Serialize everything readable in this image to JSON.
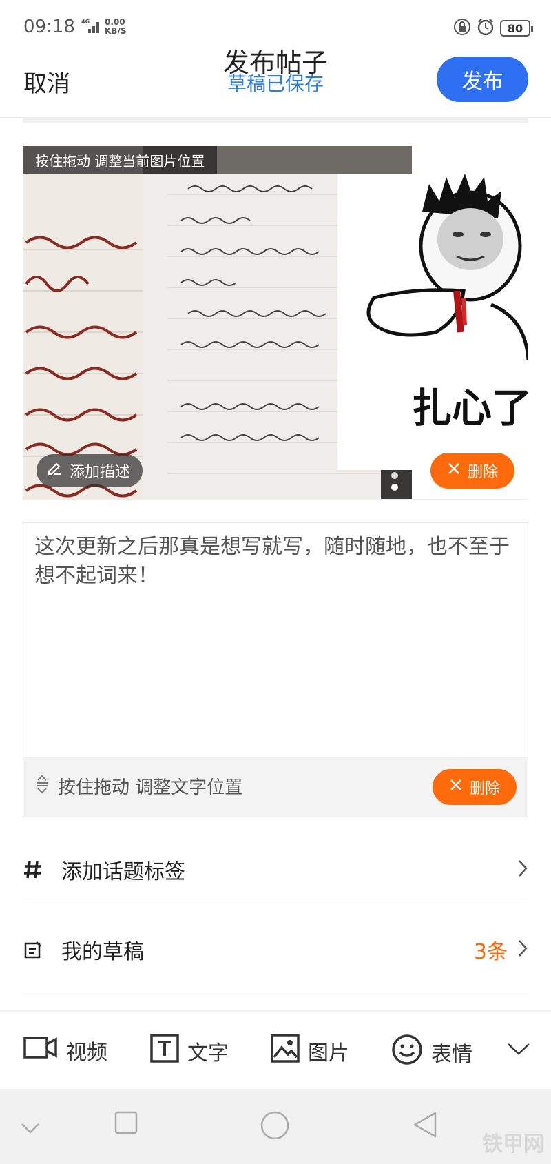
{
  "status_bar": {
    "time": "09:18",
    "network": "4G",
    "speed_value": "0.00",
    "speed_unit": "KB/S",
    "battery": "80"
  },
  "header": {
    "cancel_label": "取消",
    "title": "发布帖子",
    "subtitle": "草稿已保存",
    "publish_label": "发布"
  },
  "image_card": {
    "drag_hint": "按住拖动 调整当前图片位置",
    "add_description_label": "添加描述",
    "delete_label": "删除",
    "meme_text": "扎心了"
  },
  "text_block": {
    "content": "这次更新之后那真是想写就写，随时随地，也不至于想不起词来！",
    "drag_hint": "按住拖动 调整文字位置",
    "delete_label": "删除"
  },
  "rows": {
    "topic": {
      "label": "添加话题标签"
    },
    "drafts": {
      "label": "我的草稿",
      "count": "3条"
    }
  },
  "toolbar": {
    "video": "视频",
    "text": "文字",
    "image": "图片",
    "emoji": "表情"
  },
  "watermark": "铁甲网",
  "colors": {
    "accent_blue": "#2f6ff2",
    "subtitle_blue": "#2f7be6",
    "delete_orange": "#ff6a0d"
  },
  "icons": {
    "signal": "signal-icon",
    "lock_rotation": "rotation-lock-icon",
    "alarm": "alarm-icon",
    "battery": "battery-icon",
    "edit": "pencil-icon",
    "close": "close-icon",
    "drag": "drag-handle-icon",
    "hash": "hash-icon",
    "draft": "draft-icon",
    "chevron": "chevron-right-icon",
    "video": "video-icon",
    "text": "text-icon",
    "image": "image-icon",
    "emoji": "emoji-icon",
    "collapse": "chevron-down-icon"
  }
}
